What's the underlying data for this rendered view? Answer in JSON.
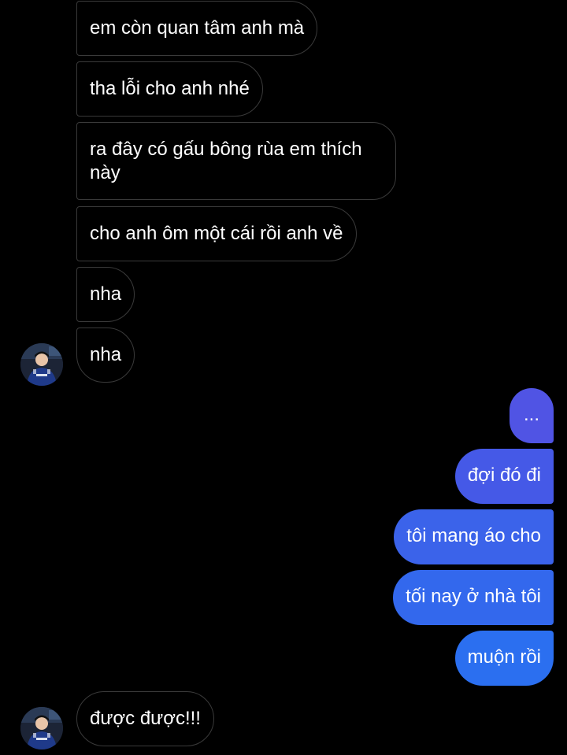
{
  "colors": {
    "background": "#000000",
    "incoming_border": "#3a3a3a",
    "outgoing_top": "#5054e4",
    "outgoing_mid": "#3b63ea",
    "outgoing_bottom": "#2b6ff0"
  },
  "incoming_group_1": {
    "messages": [
      "em còn quan tâm anh mà",
      "tha lỗi cho anh nhé",
      "ra đây có gấu bông rùa em thích này",
      "cho anh ôm một cái rồi anh về",
      "nha",
      "nha"
    ],
    "avatar_icon": "user-avatar-icon"
  },
  "outgoing_group": {
    "messages": [
      "...",
      "đợi đó đi",
      "tôi mang áo cho",
      "tối nay ở nhà tôi",
      "muộn rồi"
    ]
  },
  "incoming_group_2": {
    "messages": [
      "được được!!!"
    ],
    "avatar_icon": "user-avatar-icon"
  }
}
